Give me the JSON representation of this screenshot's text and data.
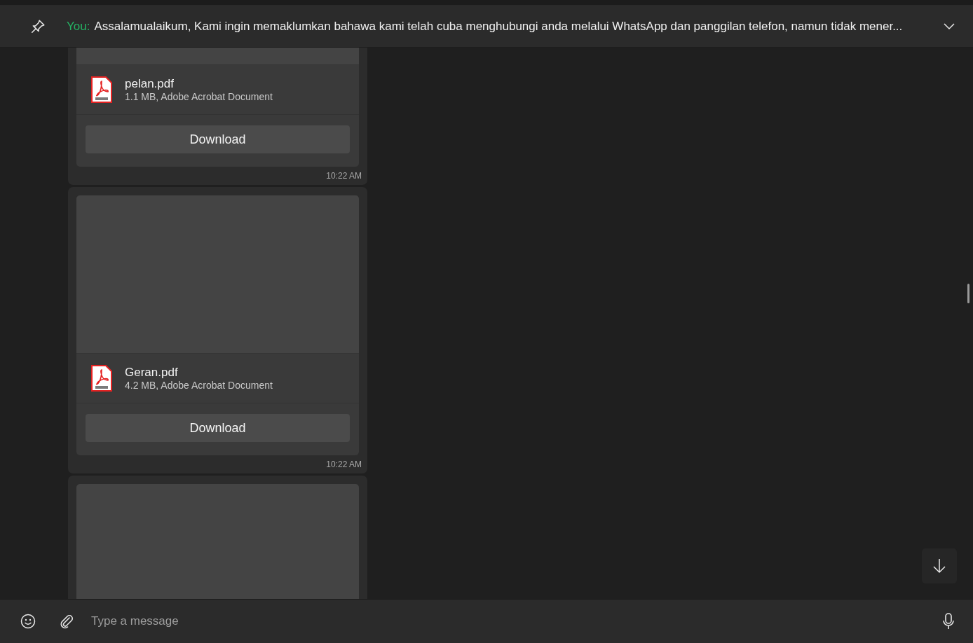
{
  "pinned_message": {
    "sender": "You:",
    "text": "Assalamualaikum,  Kami ingin memaklumkan bahawa kami telah cuba menghubungi anda melalui WhatsApp dan panggilan telefon, namun tidak mener..."
  },
  "messages": [
    {
      "kind": "document",
      "file_name": "pelan.pdf",
      "file_info": "1.1 MB, Adobe Acrobat Document",
      "button": "Download",
      "time": "10:22 AM"
    },
    {
      "kind": "document",
      "file_name": "Geran.pdf",
      "file_info": "4.2 MB, Adobe Acrobat Document",
      "button": "Download",
      "time": "10:22 AM"
    },
    {
      "kind": "document"
    }
  ],
  "composer": {
    "placeholder": "Type a message"
  }
}
